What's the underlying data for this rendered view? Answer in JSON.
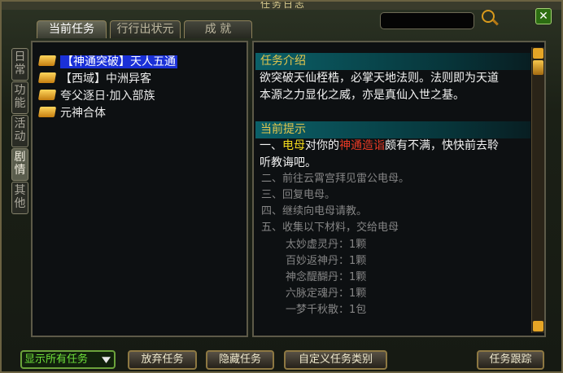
{
  "window": {
    "title": "任务日志"
  },
  "tabs": [
    {
      "label": "当前任务",
      "active": true
    },
    {
      "label": "行行出状元",
      "active": false
    },
    {
      "label": "成 就",
      "active": false
    }
  ],
  "side_tabs": [
    {
      "label": "日常"
    },
    {
      "label": "功能"
    },
    {
      "label": "活动"
    },
    {
      "label": "剧情",
      "active": true
    },
    {
      "label": "其他"
    }
  ],
  "quests": [
    {
      "bracket": "【神通突破】",
      "name": "天人五通",
      "selected": true
    },
    {
      "bracket": "【西域】",
      "name": "中洲异客"
    },
    {
      "bracket": "",
      "name": "夸父逐日·加入部族"
    },
    {
      "bracket": "",
      "name": "元神合体"
    }
  ],
  "details": {
    "intro_heading": "任务介绍",
    "intro_line1": "欲突破天仙桎梏，必掌天地法则。法则即为天道",
    "intro_line2": "本源之力显化之威，亦是真仙入世之基。",
    "hint_heading": "当前提示",
    "current_step": {
      "prefix": "一、",
      "npc": "电母",
      "mid": "对你的",
      "keyword": "神通造诣",
      "suffix": "颇有不满，快快前去聆",
      "line2": "听教诲吧。"
    },
    "steps": [
      "二、前往云霄宫拜见雷公电母。",
      "三、回复电母。",
      "四、继续向电母请教。",
      "五、收集以下材料，交给电母"
    ],
    "materials": [
      "太妙虚灵丹：1颗",
      "百妙返神丹：1颗",
      "神念醍醐丹：1颗",
      "六脉定魂丹：1颗",
      "一梦千秋散：1包"
    ]
  },
  "footer": {
    "filter": "显示所有任务",
    "abandon": "放弃任务",
    "hide": "隐藏任务",
    "custom_category": "自定义任务类别",
    "track": "任务跟踪"
  },
  "colors": {
    "selected_bg": "#1a30d7",
    "npc": "#f2db1d",
    "keyword": "#e93a25",
    "heading": "#e4c64d",
    "filter_text": "#6ee03a"
  },
  "icons": [
    "magnifier-icon",
    "close-icon",
    "book-icon",
    "scroll-up-icon",
    "scroll-down-icon",
    "chevron-down-icon"
  ]
}
